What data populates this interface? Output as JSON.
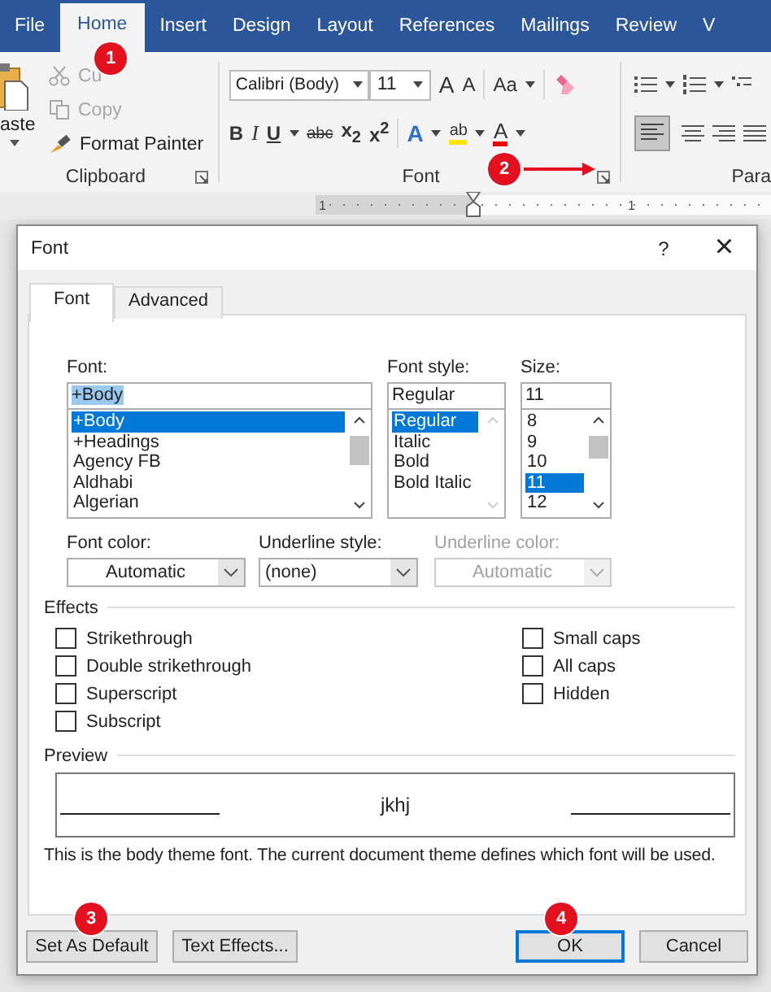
{
  "ribbon": {
    "tabs": [
      {
        "label": "File",
        "selected": false
      },
      {
        "label": "Home",
        "selected": true
      },
      {
        "label": "Insert",
        "selected": false
      },
      {
        "label": "Design",
        "selected": false
      },
      {
        "label": "Layout",
        "selected": false
      },
      {
        "label": "References",
        "selected": false
      },
      {
        "label": "Mailings",
        "selected": false
      },
      {
        "label": "Review",
        "selected": false
      },
      {
        "label": "V",
        "selected": false
      }
    ],
    "clipboard": {
      "paste": "aste",
      "items": [
        {
          "kind": "cut",
          "label": "Cu",
          "disabled": true
        },
        {
          "kind": "copy",
          "label": "Copy",
          "disabled": true
        },
        {
          "kind": "painter",
          "label": "Format Painter",
          "disabled": false
        }
      ],
      "label": "Clipboard"
    },
    "font": {
      "font_name": "Calibri (Body)",
      "font_size": "11",
      "grow": "A",
      "shrink": "A",
      "change_case": "Aa",
      "bold": "B",
      "italic": "I",
      "underline": "U",
      "strikethrough": "abc",
      "subscript": "x$_{2}$",
      "superscript": "x$^{2}$",
      "text_effects": "A",
      "highlight": "ab",
      "font_color": "A",
      "label": "Font"
    },
    "paragraph": {
      "label": "Para"
    }
  },
  "ruler": {
    "numbers": [
      "1",
      "1"
    ]
  },
  "dialog": {
    "title": "Font",
    "help": "?",
    "close": "×",
    "tabs": [
      {
        "label": "Font",
        "selected": true
      },
      {
        "label": "Advanced",
        "selected": false
      }
    ],
    "font": {
      "label": "Font:",
      "value": "+Body",
      "value_selected": true,
      "items": [
        {
          "label": "+Body",
          "selected": true
        },
        {
          "label": "+Headings",
          "selected": false
        },
        {
          "label": "Agency FB",
          "selected": false
        },
        {
          "label": "Aldhabi",
          "selected": false
        },
        {
          "label": "Algerian",
          "selected": false
        }
      ]
    },
    "style": {
      "label": "Font style:",
      "value": "Regular",
      "items": [
        {
          "label": "Regular",
          "selected": true
        },
        {
          "label": "Italic",
          "selected": false
        },
        {
          "label": "Bold",
          "selected": false
        },
        {
          "label": "Bold Italic",
          "selected": false
        }
      ]
    },
    "size": {
      "label": "Size:",
      "value": "11",
      "items": [
        {
          "label": "8",
          "selected": false
        },
        {
          "label": "9",
          "selected": false
        },
        {
          "label": "10",
          "selected": false
        },
        {
          "label": "11",
          "selected": true
        },
        {
          "label": "12",
          "selected": false
        }
      ]
    },
    "dropdowns": [
      {
        "label": "Font color:",
        "value": "Automatic",
        "disabled": false,
        "centered": true
      },
      {
        "label": "Underline style:",
        "value": "(none)",
        "disabled": false,
        "centered": false
      },
      {
        "label": "Underline color:",
        "value": "Automatic",
        "disabled": true,
        "centered": true
      }
    ],
    "effects": {
      "label": "Effects",
      "left": [
        {
          "label": "Strikethrough",
          "checked": false
        },
        {
          "label": "Double strikethrough",
          "checked": false
        },
        {
          "label": "Superscript",
          "checked": false
        },
        {
          "label": "Subscript",
          "checked": false
        }
      ],
      "right": [
        {
          "label": "Small caps",
          "checked": false
        },
        {
          "label": "All caps",
          "checked": false
        },
        {
          "label": "Hidden",
          "checked": false
        }
      ]
    },
    "preview": {
      "label": "Preview",
      "sample": "jkhj",
      "description": "This is the body theme font. The current document theme defines which font will be used."
    },
    "buttons": [
      {
        "label": "Set As Default",
        "default": false
      },
      {
        "label": "Text Effects...",
        "default": false
      },
      {
        "label": "OK",
        "default": true
      },
      {
        "label": "Cancel",
        "default": false
      }
    ]
  },
  "callouts": [
    "1",
    "2",
    "3",
    "4"
  ]
}
